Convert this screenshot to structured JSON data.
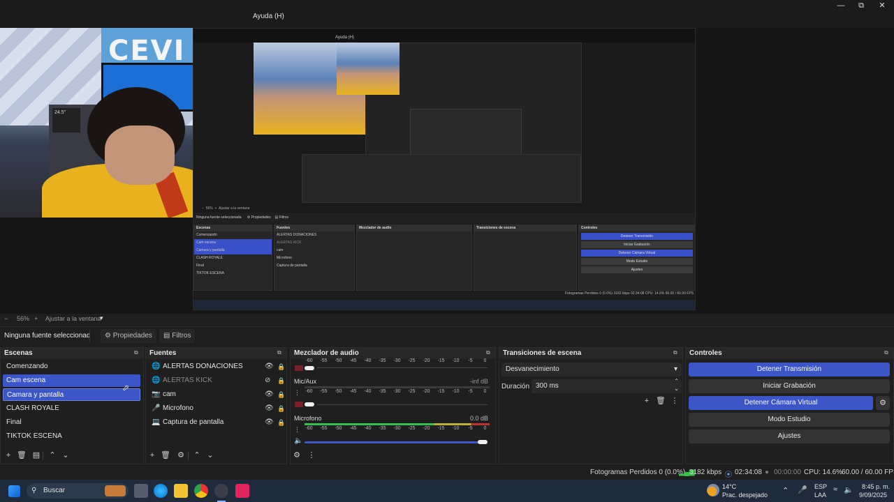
{
  "window": {
    "menu_help": "Ayuda (H)",
    "icons": [
      "minimize-icon",
      "restore-icon",
      "close-icon"
    ]
  },
  "preview": {
    "poster_text": "CEVI",
    "nested_menu": "Ayuda (H)",
    "nested_scenes": [
      "Comenzando",
      "Cam escena",
      "Camara y pantalla",
      "CLASH ROYALE",
      "Final",
      "TIKTOK ESCENA"
    ],
    "nested_sources": [
      "ALERTAS DONACIONES",
      "ALERTAS KICK",
      "cam",
      "Microfono",
      "Captura de pantalla"
    ],
    "nested_controls": [
      "Detener Transmisión",
      "Iniciar Grabación",
      "Detener Cámara Virtual",
      "Modo Estudio",
      "Ajustes"
    ],
    "nested_status": "Fotogramas Perdidos 0 (0.0%)   3182 kbps   02:34:08   CPU: 14.6%   60.00 / 60.00 FPS",
    "nested_docks": [
      "Escenas",
      "Fuentes",
      "Mezclador de audio",
      "Transiciones de escena",
      "Controles"
    ]
  },
  "zoom": {
    "minus": "−",
    "value": "56%",
    "plus": "+",
    "fit": "Ajustar a la ventana"
  },
  "propbar": {
    "no_source": "Ninguna fuente seleccionad",
    "properties": "Propiedades",
    "filters": "Filtros"
  },
  "scenes": {
    "title": "Escenas",
    "items": [
      "Comenzando",
      "Cam escena",
      "Camara y pantalla",
      "CLASH ROYALE",
      "Final",
      "TIKTOK ESCENA"
    ],
    "active_index": 1
  },
  "sources": {
    "title": "Fuentes",
    "items": [
      "ALERTAS DONACIONES",
      "ALERTAS KICK",
      "cam",
      "Microfono",
      "Captura de pantalla"
    ]
  },
  "mixer": {
    "title": "Mezclador de audio",
    "scale": [
      "-60",
      "-55",
      "-50",
      "-45",
      "-40",
      "-35",
      "-30",
      "-25",
      "-20",
      "-15",
      "-10",
      "-5",
      "0"
    ],
    "scale_top": [
      "-60",
      "-55",
      "-50",
      "-45",
      "-40",
      "-35",
      "-30",
      "-25",
      "-20",
      "-15",
      "-10",
      "-5",
      "0"
    ],
    "channels": [
      {
        "name": "Mic/Aux",
        "level": "-inf dB"
      },
      {
        "name": "Microfono",
        "level": "0.0 dB"
      }
    ]
  },
  "transitions": {
    "title": "Transiciones de escena",
    "selected": "Desvanecimiento",
    "duration_label": "Duración",
    "duration_value": "300 ms"
  },
  "controls": {
    "title": "Controles",
    "stop_stream": "Detener Transmisión",
    "start_record": "Iniciar Grabación",
    "stop_virtualcam": "Detener Cámara Virtual",
    "studio_mode": "Modo Estudio",
    "settings": "Ajustes"
  },
  "status": {
    "dropped": "Fotogramas Perdidos 0 (0.0%)",
    "bitrate": "3182 kbps",
    "stream_time": "02:34:08",
    "record_time": "00:00:00",
    "cpu": "CPU: 14.6%",
    "fps": "60.00 / 60.00 FPS"
  },
  "taskbar": {
    "search": "Buscar",
    "weather_temp": "14°C",
    "weather_desc": "Prac. despejado",
    "lang": "ESP",
    "layout": "LAA",
    "time": "8:45 p. m.",
    "date": "9/09/2025"
  },
  "colors": {
    "accent": "#3c55c8",
    "panel": "#1f1f1f",
    "background": "#1e1e1e"
  }
}
